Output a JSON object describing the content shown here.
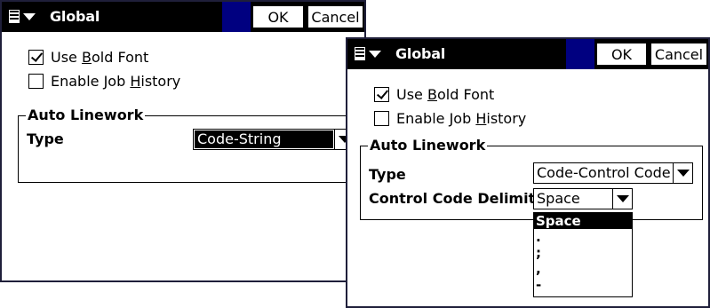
{
  "dialog1": {
    "title": "Global",
    "ok": "OK",
    "cancel": "Cancel",
    "bold_font": {
      "pre": "Use ",
      "key": "B",
      "post": "old Font",
      "checked": true
    },
    "job_history": {
      "pre": "Enable Job ",
      "key": "H",
      "post": "istory",
      "checked": false
    },
    "group_label": "Auto Linework",
    "type_label": "Type",
    "type_value": "Code-String"
  },
  "dialog2": {
    "title": "Global",
    "ok": "OK",
    "cancel": "Cancel",
    "bold_font": {
      "pre": "Use ",
      "key": "B",
      "post": "old Font",
      "checked": true
    },
    "job_history": {
      "pre": "Enable Job ",
      "key": "H",
      "post": "istory",
      "checked": false
    },
    "group_label": "Auto Linework",
    "type_label": "Type",
    "type_value": "Code-Control Code",
    "delimiter_label": "Control Code Delimite",
    "delimiter_value": "Space",
    "delimiter_options": [
      "Space",
      ".",
      ";",
      ",",
      "-"
    ]
  }
}
